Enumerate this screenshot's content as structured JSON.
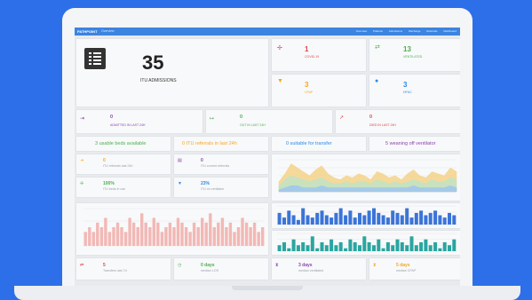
{
  "header": {
    "brand": "PATHPOINT",
    "subtitle": "Overview",
    "nav": [
      "Overview",
      "Patients",
      "Admissions",
      "Discharge",
      "Referrals",
      "Dashboard"
    ]
  },
  "admissions": {
    "value": "35",
    "label": "ITU ADMISSIONS"
  },
  "stats": [
    {
      "value": "1",
      "label": "COVID-19",
      "color": "#e2454a"
    },
    {
      "value": "13",
      "label": "VENTILATED",
      "color": "#4caf50"
    },
    {
      "value": "3",
      "label": "CPAP",
      "color": "#f5a623"
    },
    {
      "value": "3",
      "label": "HFNC",
      "color": "#2d8ae6"
    }
  ],
  "flows": [
    {
      "value": "0",
      "label": "ADMITTED IN LAST 24H",
      "color": "#8e44ad"
    },
    {
      "value": "0",
      "label": "OUT IN LAST 24H",
      "color": "#4caf50"
    },
    {
      "value": "0",
      "label": "DIED IN LAST 24H",
      "color": "#e2454a"
    }
  ],
  "pills": [
    {
      "num": "3",
      "text": "usable beds available",
      "color": "#4caf50"
    },
    {
      "num": "0",
      "text": "ITU referrals in last 24h",
      "color": "#f5a623"
    },
    {
      "num": "0",
      "text": "suitable for transfer",
      "color": "#2d8ae6"
    },
    {
      "num": "5",
      "text": "weaning off ventilator",
      "color": "#8e44ad"
    }
  ],
  "minis": [
    {
      "value": "0",
      "label": "ITU referrals last 24h",
      "color": "#f5a623"
    },
    {
      "value": "0",
      "label": "ITU current referrals",
      "color": "#8e44ad"
    },
    {
      "value": "100%",
      "label": "ITU beds in use",
      "color": "#4caf50"
    },
    {
      "value": "23%",
      "label": "ITU on ventilator",
      "color": "#2d8ae6"
    }
  ],
  "bottom": [
    {
      "value": "5",
      "label": "Transfers last 7d",
      "color": "#e2454a"
    },
    {
      "value": "0 days",
      "label": "median LOS",
      "color": "#4caf50"
    },
    {
      "value": "3 days",
      "label": "median ventilated",
      "color": "#8e44ad"
    },
    {
      "value": "5 days",
      "label": "median CPAP",
      "color": "#f5a623"
    }
  ],
  "chart_data": [
    {
      "type": "area",
      "x": [
        0,
        1,
        2,
        3,
        4,
        5,
        6,
        7,
        8,
        9,
        10,
        11,
        12,
        13,
        14,
        15,
        16,
        17,
        18,
        19,
        20,
        21,
        22,
        23,
        24,
        25,
        26,
        27,
        28,
        29
      ],
      "series": [
        {
          "values": [
            5,
            9,
            14,
            12,
            10,
            8,
            11,
            13,
            9,
            7,
            6,
            8,
            7,
            9,
            8,
            6,
            10,
            9,
            7,
            8,
            6,
            9,
            11,
            8,
            7,
            10,
            9,
            8,
            12,
            10
          ],
          "color": "#f5d48a"
        },
        {
          "values": [
            3,
            6,
            8,
            7,
            6,
            5,
            6,
            7,
            5,
            4,
            4,
            5,
            4,
            5,
            5,
            4,
            6,
            5,
            4,
            5,
            4,
            5,
            6,
            5,
            4,
            6,
            5,
            5,
            7,
            6
          ],
          "color": "#bfe3c6"
        },
        {
          "values": [
            1,
            2,
            3,
            3,
            2,
            2,
            2,
            3,
            2,
            2,
            2,
            2,
            2,
            2,
            2,
            2,
            2,
            2,
            2,
            2,
            2,
            2,
            3,
            2,
            2,
            2,
            2,
            2,
            3,
            2
          ],
          "color": "#9ec6ee"
        }
      ]
    },
    {
      "type": "bar",
      "values": [
        3,
        4,
        3,
        5,
        4,
        6,
        3,
        4,
        5,
        4,
        3,
        6,
        5,
        4,
        7,
        5,
        4,
        6,
        5,
        3,
        4,
        5,
        4,
        6,
        5,
        4,
        3,
        5,
        4,
        6,
        5,
        7,
        4,
        5,
        6,
        4,
        5,
        3,
        4,
        6,
        5,
        4,
        5,
        3,
        4
      ],
      "color": "#f2b8b5"
    },
    {
      "type": "bar",
      "values": [
        5,
        3,
        6,
        4,
        2,
        7,
        4,
        3,
        5,
        6,
        4,
        3,
        5,
        7,
        4,
        6,
        3,
        5,
        4,
        6,
        7,
        5,
        4,
        3,
        6,
        5,
        4,
        7,
        3,
        5,
        6,
        4,
        5,
        6,
        4,
        3,
        5,
        4
      ],
      "color": "#3a74d8"
    },
    {
      "type": "bar",
      "values": [
        2,
        3,
        1,
        4,
        2,
        3,
        2,
        5,
        1,
        3,
        2,
        4,
        2,
        3,
        1,
        4,
        3,
        2,
        5,
        3,
        2,
        4,
        1,
        3,
        2,
        4,
        3,
        2,
        5,
        2,
        3,
        4,
        2,
        3,
        1,
        3,
        2,
        4
      ],
      "color": "#2aa5a0"
    }
  ]
}
